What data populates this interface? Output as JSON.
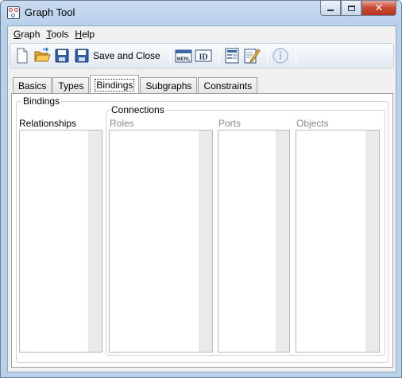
{
  "window": {
    "title": "Graph Tool"
  },
  "menubar": {
    "items": [
      {
        "label": "Graph",
        "mnemonic": "G",
        "rest": "raph"
      },
      {
        "label": "Tools",
        "mnemonic": "T",
        "rest": "ools"
      },
      {
        "label": "Help",
        "mnemonic": "H",
        "rest": "elp"
      }
    ]
  },
  "toolbar": {
    "save_close_label": "Save and Close",
    "merl_label": "MERL",
    "id_label": "ID"
  },
  "tabs": [
    {
      "label": "Basics"
    },
    {
      "label": "Types"
    },
    {
      "label": "Bindings",
      "active": true
    },
    {
      "label": "Subgraphs"
    },
    {
      "label": "Constraints"
    }
  ],
  "bindings": {
    "group_label": "Bindings",
    "relationships_label": "Relationships",
    "connections": {
      "group_label": "Connections",
      "roles_label": "Roles",
      "ports_label": "Ports",
      "objects_label": "Objects"
    }
  },
  "colors": {
    "titlebar": "#b9d1ea",
    "close_button": "#c9462f",
    "disabled_text": "#8a8a8a"
  }
}
